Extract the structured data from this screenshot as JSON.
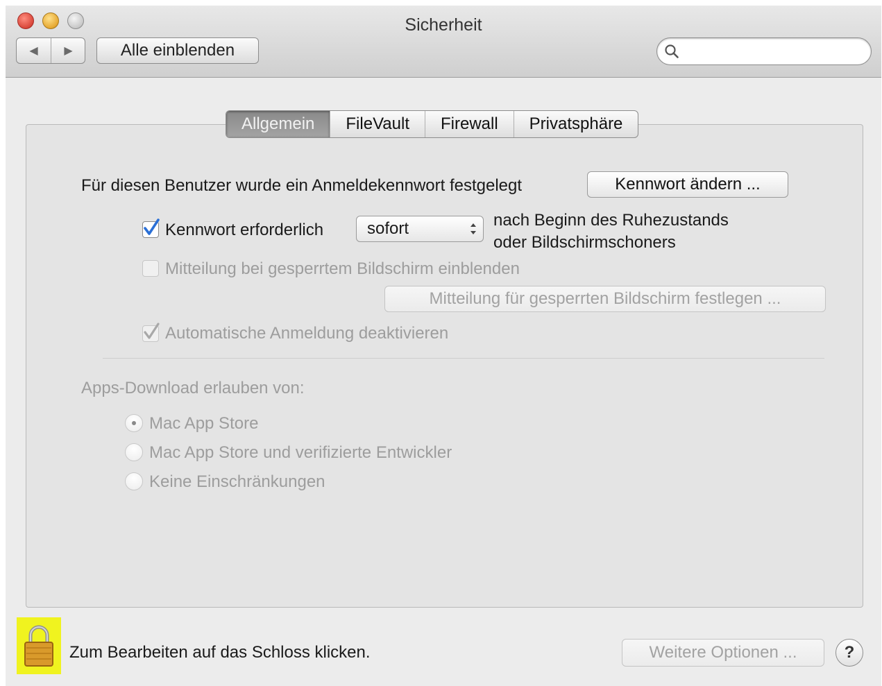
{
  "window": {
    "title": "Sicherheit"
  },
  "toolbar": {
    "show_all_label": "Alle einblenden",
    "search_placeholder": ""
  },
  "tabs": [
    {
      "label": "Allgemein",
      "active": true
    },
    {
      "label": "FileVault",
      "active": false
    },
    {
      "label": "Firewall",
      "active": false
    },
    {
      "label": "Privatsphäre",
      "active": false
    }
  ],
  "general": {
    "password_set_text": "Für diesen Benutzer wurde ein Anmeldekennwort festgelegt",
    "change_password_label": "Kennwort ändern ...",
    "require_password_label": "Kennwort erforderlich",
    "require_password_checked": true,
    "delay_value": "sofort",
    "after_text_line1": "nach Beginn des Ruhezustands",
    "after_text_line2": "oder Bildschirmschoners",
    "show_message_label": "Mitteilung bei gesperrtem Bildschirm einblenden",
    "show_message_checked": false,
    "set_message_label": "Mitteilung für gesperrten Bildschirm festlegen ...",
    "disable_autologin_label": "Automatische Anmeldung deaktivieren",
    "disable_autologin_checked": true
  },
  "apps_download": {
    "heading": "Apps-Download erlauben von:",
    "options": [
      {
        "label": "Mac App Store",
        "selected": true
      },
      {
        "label": "Mac App Store und verifizierte Entwickler",
        "selected": false
      },
      {
        "label": "Keine Einschränkungen",
        "selected": false
      }
    ]
  },
  "footer": {
    "lock_text": "Zum Bearbeiten auf das Schloss klicken.",
    "advanced_label": "Weitere Optionen ...",
    "help_label": "?"
  },
  "colors": {
    "lock_highlight": "#f0f31f",
    "checkbox_blue": "#2a6fd6"
  }
}
